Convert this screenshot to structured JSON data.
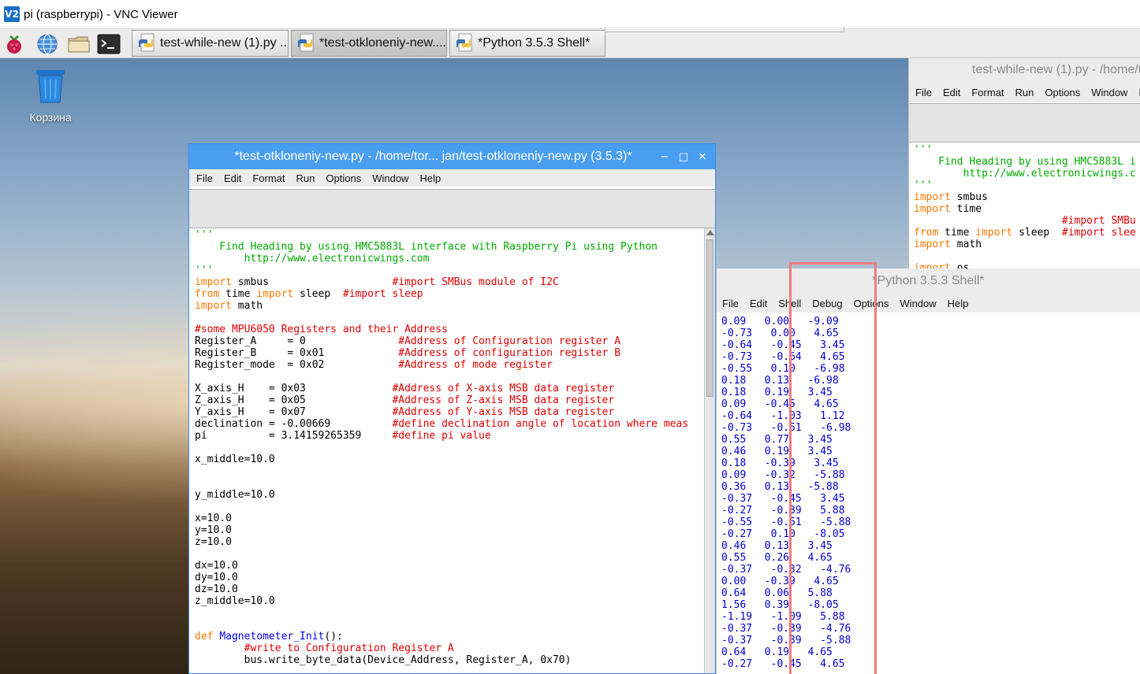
{
  "vnc": {
    "title": "pi (raspberrypi) - VNC Viewer",
    "logo_text": "V2"
  },
  "taskbar": {
    "launchers": [
      "raspberry-menu-icon",
      "web-browser-icon",
      "file-manager-icon",
      "terminal-icon"
    ],
    "tasks": [
      {
        "label": "test-while-new (1).py ..."
      },
      {
        "label": "*test-otkloneniy-new...."
      },
      {
        "label": "*Python 3.5.3 Shell*"
      }
    ]
  },
  "desktop": {
    "trash_label": "Корзина"
  },
  "main_window": {
    "title": "*test-otkloneniy-new.py - /home/tor... jan/test-otkloneniy-new.py (3.5.3)*",
    "menu": [
      "File",
      "Edit",
      "Format",
      "Run",
      "Options",
      "Window",
      "Help"
    ],
    "controls": {
      "minimize": "−",
      "maximize": "□",
      "close": "✕"
    },
    "code": [
      [
        [
          "'''",
          "str"
        ]
      ],
      [
        [
          "    Find Heading by using HMC5883L interface with Raspberry Pi using Python",
          "str"
        ]
      ],
      [
        [
          "        http://www.electronicwings.com",
          "str"
        ]
      ],
      [
        [
          "'''",
          "str"
        ]
      ],
      [
        [
          "import",
          "kw"
        ],
        [
          " smbus                    ",
          "n"
        ],
        [
          "#import SMBus module of I2C",
          "com"
        ]
      ],
      [
        [
          "from",
          "kw"
        ],
        [
          " time ",
          "n"
        ],
        [
          "import",
          "kw"
        ],
        [
          " sleep  ",
          "n"
        ],
        [
          "#import sleep",
          "com"
        ]
      ],
      [
        [
          "import",
          "kw"
        ],
        [
          " math",
          "n"
        ]
      ],
      [
        [
          "",
          "n"
        ]
      ],
      [
        [
          "#some MPU6050 Registers and their Address",
          "com"
        ]
      ],
      [
        [
          "Register_A     = 0               ",
          "n"
        ],
        [
          "#Address of Configuration register A",
          "com"
        ]
      ],
      [
        [
          "Register_B     = 0x01            ",
          "n"
        ],
        [
          "#Address of configuration register B",
          "com"
        ]
      ],
      [
        [
          "Register_mode  = 0x02            ",
          "n"
        ],
        [
          "#Address of mode register",
          "com"
        ]
      ],
      [
        [
          "",
          "n"
        ]
      ],
      [
        [
          "X_axis_H    = 0x03              ",
          "n"
        ],
        [
          "#Address of X-axis MSB data register",
          "com"
        ]
      ],
      [
        [
          "Z_axis_H    = 0x05              ",
          "n"
        ],
        [
          "#Address of Z-axis MSB data register",
          "com"
        ]
      ],
      [
        [
          "Y_axis_H    = 0x07              ",
          "n"
        ],
        [
          "#Address of Y-axis MSB data register",
          "com"
        ]
      ],
      [
        [
          "declination = -0.00669          ",
          "n"
        ],
        [
          "#define declination angle of location where meas",
          "com"
        ]
      ],
      [
        [
          "pi          = 3.14159265359     ",
          "n"
        ],
        [
          "#define pi value",
          "com"
        ]
      ],
      [
        [
          "",
          "n"
        ]
      ],
      [
        [
          "x_middle=10.0",
          "n"
        ]
      ],
      [
        [
          "",
          "n"
        ]
      ],
      [
        [
          "",
          "n"
        ]
      ],
      [
        [
          "y_middle=10.0",
          "n"
        ]
      ],
      [
        [
          "",
          "n"
        ]
      ],
      [
        [
          "x=10.0",
          "n"
        ]
      ],
      [
        [
          "y=10.0",
          "n"
        ]
      ],
      [
        [
          "z=10.0",
          "n"
        ]
      ],
      [
        [
          "",
          "n"
        ]
      ],
      [
        [
          "dx=10.0",
          "n"
        ]
      ],
      [
        [
          "dy=10.0",
          "n"
        ]
      ],
      [
        [
          "dz=10.0",
          "n"
        ]
      ],
      [
        [
          "z_middle=10.0",
          "n"
        ]
      ],
      [
        [
          "",
          "n"
        ]
      ],
      [
        [
          "",
          "n"
        ]
      ],
      [
        [
          "def",
          "kw"
        ],
        [
          " ",
          "n"
        ],
        [
          "Magnetometer_Init",
          "def"
        ],
        [
          "():",
          "n"
        ]
      ],
      [
        [
          "        ",
          "n"
        ],
        [
          "#write to Configuration Register A",
          "com"
        ]
      ],
      [
        [
          "        bus.write_byte_data(Device_Address, Register_A, 0x70)",
          "n"
        ]
      ]
    ]
  },
  "right_window": {
    "title": "test-while-new (1).py - /home/t",
    "menu": [
      "File",
      "Edit",
      "Format",
      "Run",
      "Options",
      "Window",
      "Help"
    ],
    "code": [
      [
        [
          "'''",
          "str"
        ]
      ],
      [
        [
          "    Find Heading by using HMC5883L i",
          "str"
        ]
      ],
      [
        [
          "        http://www.electronicwings.c",
          "str"
        ]
      ],
      [
        [
          "'''",
          "str"
        ]
      ],
      [
        [
          "import",
          "kw"
        ],
        [
          " smbus",
          "n"
        ]
      ],
      [
        [
          "import",
          "kw"
        ],
        [
          " time",
          "n"
        ]
      ],
      [
        [
          "                        ",
          "n"
        ],
        [
          "#import SMBu",
          "com"
        ]
      ],
      [
        [
          "from",
          "kw"
        ],
        [
          " time ",
          "n"
        ],
        [
          "import",
          "kw"
        ],
        [
          " sleep  ",
          "n"
        ],
        [
          "#import slee",
          "com"
        ]
      ],
      [
        [
          "import",
          "kw"
        ],
        [
          " math",
          "n"
        ]
      ],
      [
        [
          "",
          "n"
        ]
      ],
      [
        [
          "import",
          "kw"
        ],
        [
          " os",
          "n"
        ]
      ]
    ]
  },
  "shell_window": {
    "title": "*Python 3.5.3 Shell*",
    "menu": [
      "File",
      "Edit",
      "Shell",
      "Debug",
      "Options",
      "Window",
      "Help"
    ],
    "output": [
      "0.09   0.00   -9.09",
      "-0.73   0.00   4.65",
      "-0.64   -0.45   3.45",
      "-0.73   -0.64   4.65",
      "-0.55   0.10   -6.98",
      "0.18   0.13   -6.98",
      "0.18   0.19   3.45",
      "0.09   -0.45   4.65",
      "-0.64   -1.03   1.12",
      "-0.73   -0.51   -6.98",
      "0.55   0.77   3.45",
      "0.46   0.19   3.45",
      "0.18   -0.39   3.45",
      "0.09   -0.32   -5.88",
      "0.36   0.13   -5.88",
      "-0.37   -0.45   3.45",
      "-0.27   -0.39   5.88",
      "-0.55   -0.51   -5.88",
      "-0.27   0.10   -8.05",
      "0.46   0.13   3.45",
      "0.55   0.26   4.65",
      "-0.37   -0.32   -4.76",
      "0.00   -0.39   4.65",
      "0.64   0.06   5.88",
      "1.56   0.39   -8.05",
      "-1.19   -1.09   5.88",
      "-0.37   -0.39   -4.76",
      "-0.37   -0.39   -5.88",
      "0.64   0.19   4.65",
      "-0.27   -0.45   4.65"
    ]
  },
  "colors": {
    "active_titlebar": "#4a9ef0",
    "highlight_box": "#f07a80",
    "code_string": "#00aa00",
    "code_keyword": "#ff7700",
    "code_comment": "#dd0000",
    "shell_output": "#0000cc"
  }
}
